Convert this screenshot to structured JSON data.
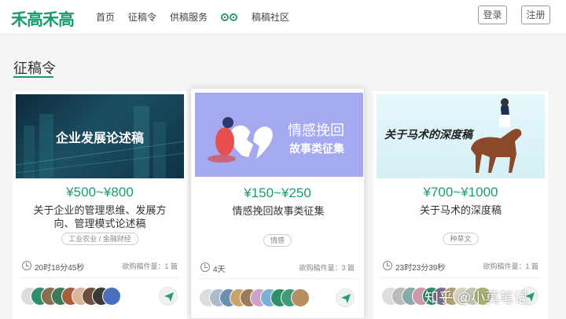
{
  "header": {
    "logo": "禾高禾高",
    "nav": [
      "首页",
      "征稿令",
      "供稿服务",
      "稿稿社区"
    ],
    "login": "登录",
    "register": "注册"
  },
  "section": {
    "title": "征稿令"
  },
  "cards": [
    {
      "banner": "企业发展论述稿",
      "price": "¥500~¥800",
      "desc": "关于企业的管理思维、发展方向、管理模式论述稿",
      "tag": "工业农业 / 金融财经",
      "time": "20时18分45秒",
      "count": "欲购稿件量：1 篇",
      "avatar_colors": [
        "#ddd",
        "#2e8f6a",
        "#8a6e4e",
        "#3d7a5a",
        "#a65e3a",
        "#d9b59a",
        "#6b5040",
        "#3a3a3a",
        "#4a6fbf"
      ]
    },
    {
      "banner": "情感挽回",
      "banner2": "故事类征集",
      "price": "¥150~¥250",
      "desc": "情感挽回故事类征集",
      "tag": "情感",
      "time": "4天",
      "count": "欲购稿件量：3 篇",
      "avatar_colors": [
        "#ddd",
        "#aabbcc",
        "#6b8fb0",
        "#c8a46b",
        "#9e7a5a",
        "#cfa2c9",
        "#7ab1d6",
        "#2e8f6a",
        "#3f9a7a",
        "#b89060"
      ]
    },
    {
      "banner": "关于马术的深度稿",
      "price": "¥700~¥1000",
      "desc": "关于马术的深度稿",
      "tag": "种草文",
      "time": "23时23分39秒",
      "count": "欲购稿件量：1 篇",
      "avatar_colors": [
        "#ddd",
        "#bbb",
        "#8aa",
        "#c9a",
        "#2e8f6a",
        "#7a6e8a",
        "#b0a070",
        "#d8d0c0",
        "#c0c8b0",
        "#aab070"
      ]
    }
  ],
  "watermark": "知乎 @小莫笔记",
  "colors": {
    "accent": "#1a9c73"
  }
}
